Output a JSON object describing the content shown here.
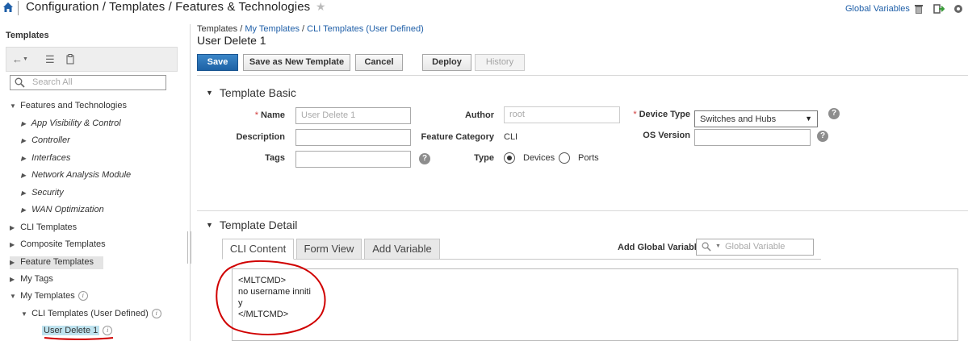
{
  "header": {
    "breadcrumb_title": "Configuration / Templates / Features & Technologies",
    "star_glyph": "★",
    "global_variables_link": "Global Variables",
    "icons": [
      "home-icon",
      "trash-icon",
      "exit-icon",
      "gear-icon"
    ]
  },
  "sidebar": {
    "title": "Templates",
    "search_placeholder": "Search All",
    "tree": {
      "features_technologies": "Features and Technologies",
      "app_visibility": "App Visibility & Control",
      "controller": "Controller",
      "interfaces": "Interfaces",
      "network_analysis": "Network Analysis Module",
      "security": "Security",
      "wan_optimization": "WAN Optimization",
      "cli_templates": "CLI Templates",
      "composite_templates": "Composite Templates",
      "feature_templates": "Feature Templates",
      "my_tags": "My Tags",
      "my_templates": "My Templates",
      "cli_user_defined": "CLI Templates (User Defined)",
      "user_delete_1": "User Delete 1"
    }
  },
  "main": {
    "breadcrumb": {
      "root": "Templates",
      "sep": " / ",
      "my_templates": "My Templates",
      "cli_user_defined": "CLI Templates (User Defined)"
    },
    "page_title": "User Delete 1",
    "buttons": {
      "save": "Save",
      "save_as_new": "Save as New Template",
      "cancel": "Cancel",
      "deploy": "Deploy",
      "history": "History"
    },
    "template_basic": {
      "heading": "Template Basic",
      "name_label": "Name",
      "name_value": "User Delete 1",
      "description_label": "Description",
      "tags_label": "Tags",
      "author_label": "Author",
      "author_value": "root",
      "feature_category_label": "Feature Category",
      "feature_category_value": "CLI",
      "type_label": "Type",
      "type_devices": "Devices",
      "type_ports": "Ports",
      "type_selected": "Devices",
      "device_type_label": "Device Type",
      "device_type_value": "Switches and Hubs",
      "os_version_label": "OS Version",
      "required_mark": "*",
      "help_glyph": "?"
    },
    "template_detail": {
      "heading": "Template Detail",
      "tabs": [
        "CLI Content",
        "Form View",
        "Add Variable"
      ],
      "active_tab": "CLI Content",
      "add_global_variable_label": "Add Global Variable",
      "global_variable_placeholder": "Global Variable",
      "cli_lines": [
        "<MLTCMD>",
        "no username inniti",
        "y",
        "</MLTCMD>"
      ]
    }
  },
  "colors": {
    "accent_blue": "#1f5fa8",
    "save_button": "#1d62a5",
    "annotation_red": "#d00000",
    "selected_highlight": "#bfe3ef"
  }
}
